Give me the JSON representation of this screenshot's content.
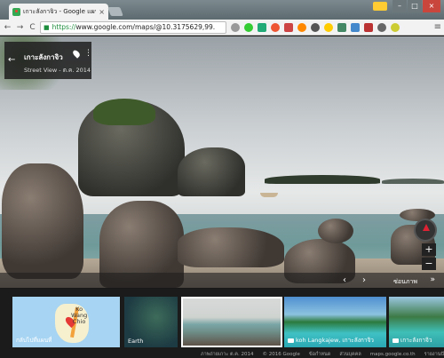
{
  "browser": {
    "tab_title": "เกาะลังกาจิว - Google แผนที่",
    "tab_close": "×",
    "url_scheme": "https://",
    "url_rest": "www.google.com/maps/@10.3175629,99.",
    "back": "←",
    "forward": "→",
    "reload": "C",
    "menu": "≡",
    "window": {
      "minimize": "–",
      "maximize": "□",
      "close": "×"
    }
  },
  "streetview": {
    "place": "เกาะลังกาจิว",
    "back_icon": "←",
    "more_icon": "⋮",
    "subtitle": "Street View - ต.ค. 2014",
    "nav_left": "‹",
    "nav_right": "›",
    "hide_label": "ซ่อนภาพ",
    "expand_icon": "»",
    "zoom_in": "+",
    "zoom_out": "−"
  },
  "filmstrip": {
    "map_label_top": "Ko",
    "map_label_mid": "Wang",
    "map_label_bot": "Chio",
    "map_caption": "กลับไปที่แผนที่",
    "earth_caption": "Earth",
    "thumb3_caption": "koh Langkajew, เกาะลังกาจิว",
    "thumb4_caption": "เกาะลังกาจิว"
  },
  "footer": {
    "imagery": "ภาพถ่ายเกาะ ต.ค. 2014",
    "copyright": "© 2016 Google",
    "privacy": "ข้อกำหนด",
    "report": "ส่วนบุคคล",
    "site": "maps.google.co.th",
    "feedback": "รายงานปัญหา"
  },
  "colors": {
    "chrome_top": "#7c8a8f",
    "panel_bg": "#222222",
    "secure_green": "#1e8e3e"
  }
}
